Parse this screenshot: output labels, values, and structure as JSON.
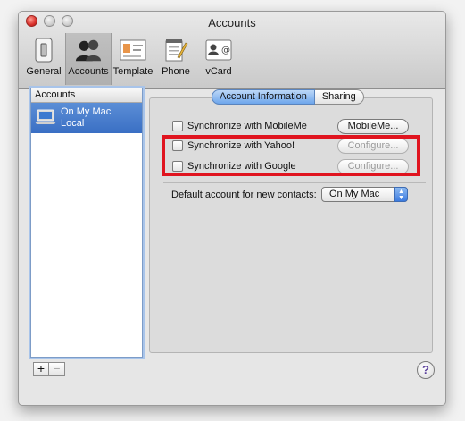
{
  "window": {
    "title": "Accounts"
  },
  "toolbar": {
    "items": [
      {
        "label": "General"
      },
      {
        "label": "Accounts"
      },
      {
        "label": "Template"
      },
      {
        "label": "Phone"
      },
      {
        "label": "vCard"
      }
    ]
  },
  "sidebar": {
    "header": "Accounts",
    "items": [
      {
        "name": "On My Mac",
        "subtitle": "Local"
      }
    ]
  },
  "tabs": [
    {
      "label": "Account Information"
    },
    {
      "label": "Sharing"
    }
  ],
  "sync": [
    {
      "label": "Synchronize with MobileMe",
      "button": "MobileMe...",
      "enabled": true
    },
    {
      "label": "Synchronize with Yahoo!",
      "button": "Configure...",
      "enabled": false
    },
    {
      "label": "Synchronize with Google",
      "button": "Configure...",
      "enabled": false
    }
  ],
  "default_account": {
    "label": "Default account for new contacts:",
    "value": "On My Mac"
  },
  "buttons": {
    "add": "+",
    "remove": "−",
    "help": "?"
  },
  "colors": {
    "highlight": "#e0141f",
    "selection": "#3a6fc4"
  }
}
